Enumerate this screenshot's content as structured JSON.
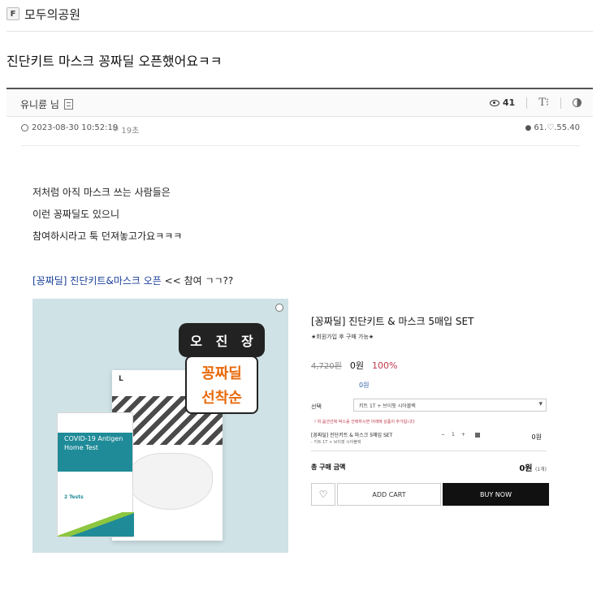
{
  "board": {
    "badge": "F",
    "name": "모두의공원"
  },
  "post": {
    "title": "진단키트 마스크 꽁짜딜 오픈했어요ㅋㅋ",
    "author": "유니륜 님",
    "views": "41",
    "font_icon_label": "T⁝",
    "date": "2023-08-30 10:52:19",
    "ago": "19초",
    "ip": "61.♡.55.40",
    "body_lines": [
      "저처럼 아직 마스크 쓰는 사람들은",
      "이런 꽁짜딜도 있으니",
      "참여하시라고 툭 던져놓고가요ㅋㅋㅋ"
    ],
    "link_text": "[꽁짜딜] 진단키트&마스크 오픈",
    "link_suffix": " << 참여 ㄱㄱ??"
  },
  "ad_image": {
    "stamp_chars": [
      "오",
      "진",
      "장"
    ],
    "stamp_line1": "꽁짜딜",
    "stamp_line2": "선착순",
    "kit_title": "COVID-19 Antigen Home Test",
    "kit_tests": "2 Tests",
    "mask_size": "L"
  },
  "shop": {
    "title": "[꽁짜딜] 진단키트 & 마스크 5매입 SET",
    "subtitle": "★회원가입 후 구매 가능★",
    "price_old": "4,720원",
    "price_new": "0원",
    "discount": "100%",
    "price_zero": "0원",
    "option_label": "선택",
    "option_value": "키트 1T + 브이핏 시아볼렉",
    "notice": "! 위 옵션선택 박스를 선택하시면 아래에 상품이 추가됩니다",
    "item_name": "[꽁짜딜] 진단키트 & 마스크 5매입 SET",
    "item_option": "- 키트 1T + 브이핏 시아볼렉",
    "qty_minus": "−",
    "qty_value": "1",
    "qty_plus": "+",
    "item_price": "0원",
    "total_label": "총 구매 금액",
    "total_value": "0원",
    "total_count": "(1개)",
    "add_cart": "ADD CART",
    "buy_now": "BUY NOW"
  }
}
